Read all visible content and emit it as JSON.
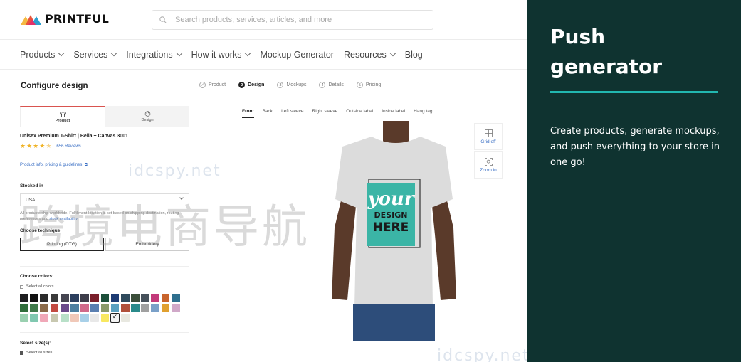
{
  "header": {
    "logo_text": "PRINTFUL",
    "search_placeholder": "Search products, services, articles, and more"
  },
  "nav": {
    "items": [
      {
        "label": "Products",
        "dropdown": true
      },
      {
        "label": "Services",
        "dropdown": true
      },
      {
        "label": "Integrations",
        "dropdown": true
      },
      {
        "label": "How it works",
        "dropdown": true
      },
      {
        "label": "Mockup Generator",
        "dropdown": false
      },
      {
        "label": "Resources",
        "dropdown": true
      },
      {
        "label": "Blog",
        "dropdown": false
      }
    ]
  },
  "configure": {
    "title": "Configure design",
    "steps": [
      {
        "num": "✓",
        "label": "Product",
        "active": false
      },
      {
        "num": "2",
        "label": "Design",
        "active": true
      },
      {
        "num": "3",
        "label": "Mockups",
        "active": false
      },
      {
        "num": "4",
        "label": "Details",
        "active": false
      },
      {
        "num": "5",
        "label": "Pricing",
        "active": false
      }
    ]
  },
  "panel_tabs": {
    "product": "Product",
    "design": "Design"
  },
  "product": {
    "name": "Unisex Premium T-Shirt | Bella + Canvas 3001",
    "rating": 4.5,
    "reviews": "656 Reviews",
    "info_link": "Product info, pricing & guidelines"
  },
  "stock": {
    "label": "Stocked in",
    "country": "USA",
    "note_prefix": "All products ship worldwide. Fulfillment location is set based on shipping destination, routing preferences and ",
    "note_link": "stock availability"
  },
  "technique": {
    "label": "Choose technique",
    "options": [
      "Printing (DTG)",
      "Embroidery"
    ],
    "selected": "Printing (DTG)"
  },
  "colors": {
    "label": "Choose colors:",
    "select_all": "Select all colors",
    "swatches": [
      "#1d1d1f",
      "#111111",
      "#2b2b2b",
      "#3a3a3a",
      "#454550",
      "#2c3f5e",
      "#3d3d4a",
      "#7a1f2b",
      "#1c4f3a",
      "#1d3b73",
      "#2f4a5c",
      "#3b4e3a",
      "#46505a",
      "#c23a7a",
      "#c8642c",
      "#2e6f8e",
      "#2f6d3a",
      "#3f7a4a",
      "#8b6b4a",
      "#c24a40",
      "#6a4a8a",
      "#4d7fa0",
      "#d06a8a",
      "#5a7fb0",
      "#8a9a6a",
      "#5aa0c0",
      "#b0503a",
      "#2a8a8a",
      "#a0a0a0",
      "#7aa0c8",
      "#e0a030",
      "#d0a8c8",
      "#9ad0b0",
      "#80c8b0",
      "#f0a8b8",
      "#c8c8b0",
      "#b8e0c8",
      "#f0c8b8",
      "#a8d0e8",
      "#e8e8e8",
      "#f8e860",
      "#f4f4f4",
      "#e8e8e0"
    ],
    "selected_index": 41
  },
  "sizes": {
    "label": "Select size(s):",
    "select_all": "Select all sizes"
  },
  "view_tabs": [
    "Front",
    "Back",
    "Left sleeve",
    "Right sleeve",
    "Outside label",
    "Inside label",
    "Hang tag"
  ],
  "view_active": "Front",
  "mockup": {
    "design_lines": [
      "your",
      "DESIGN",
      "HERE"
    ],
    "design_color": "#3bb5a6",
    "shirt_color": "#dcdcdc"
  },
  "tools": {
    "grid": "Grid off",
    "zoom": "Zoom in"
  },
  "promo": {
    "title": "Push generator",
    "body": "Create products, generate mockups, and push everything to your store in one go!",
    "bg": "#0f3330",
    "accent": "#22b8b0"
  },
  "watermark": {
    "domain": "idcspy.net",
    "cn": "跨境电商导航"
  }
}
